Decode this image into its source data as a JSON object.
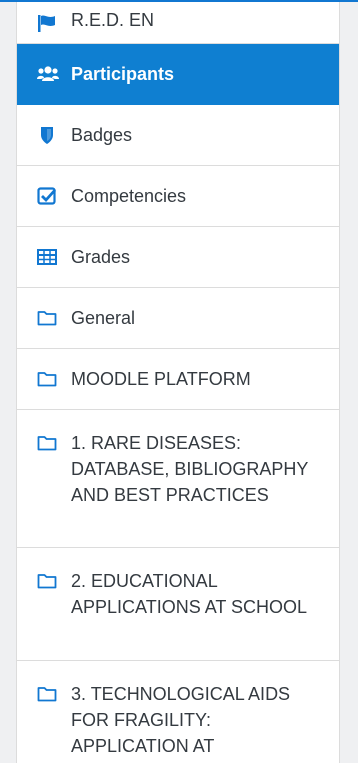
{
  "accent": "#0f7fd1",
  "icon_color": "#1177d1",
  "nav": {
    "items": [
      {
        "label": "R.E.D. EN",
        "icon": "flag-icon"
      },
      {
        "label": "Participants",
        "icon": "users-icon",
        "active": true
      },
      {
        "label": "Badges",
        "icon": "shield-icon"
      },
      {
        "label": "Competencies",
        "icon": "checkbox-icon"
      },
      {
        "label": "Grades",
        "icon": "table-icon"
      },
      {
        "label": "General",
        "icon": "folder-icon"
      },
      {
        "label": "MOODLE PLATFORM",
        "icon": "folder-icon"
      },
      {
        "label": "1. RARE DISEASES: DATABASE, BIBLIOGRAPHY AND BEST PRACTICES",
        "icon": "folder-icon"
      },
      {
        "label": "2. EDUCATIONAL APPLICATIONS AT SCHOOL",
        "icon": "folder-icon"
      },
      {
        "label": "3. TECHNOLOGICAL AIDS FOR FRAGILITY: APPLICATION AT",
        "icon": "folder-icon"
      }
    ]
  }
}
